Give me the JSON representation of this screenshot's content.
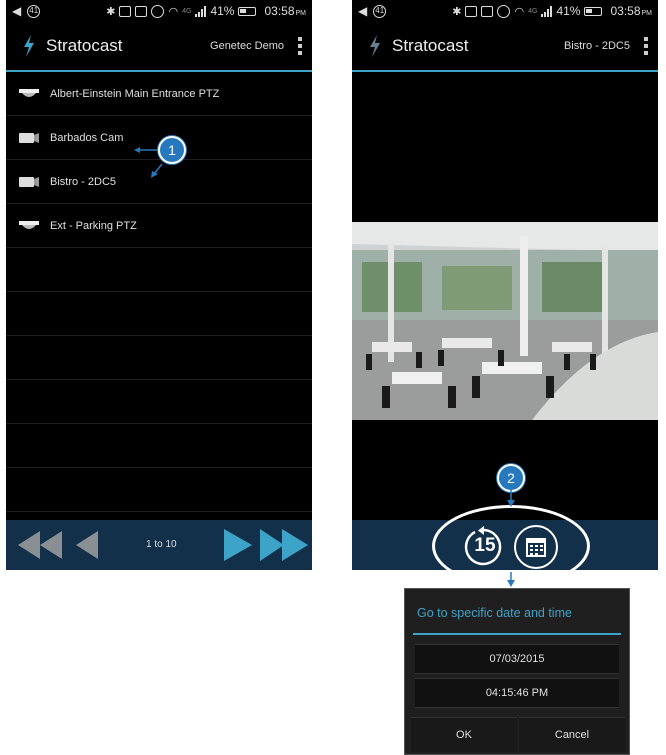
{
  "status_bar": {
    "notification_count": "41",
    "network": "4G",
    "battery": "41%",
    "time": "03:58",
    "time_suffix": "PM"
  },
  "left_screen": {
    "app_title": "Stratocast",
    "account": "Genetec Demo",
    "cameras": [
      {
        "name": "Albert-Einstein Main Entrance PTZ",
        "icon": "ptz-camera-icon"
      },
      {
        "name": "Barbados Cam",
        "icon": "fixed-camera-icon"
      },
      {
        "name": "Bistro - 2DC5",
        "icon": "fixed-camera-icon"
      },
      {
        "name": "Ext - Parking PTZ",
        "icon": "ptz-camera-icon"
      }
    ],
    "pager": {
      "range": "1 to 10"
    }
  },
  "right_screen": {
    "app_title": "Stratocast",
    "camera_name": "Bistro - 2DC5",
    "replay_label": "15",
    "dialog": {
      "title": "Go to specific date and time",
      "date": "07/03/2015",
      "time": "04:15:46 PM",
      "ok": "OK",
      "cancel": "Cancel"
    }
  },
  "callouts": {
    "one": "1",
    "two": "2"
  },
  "colors": {
    "accent": "#3ea3c8",
    "toolbar": "#123049",
    "badge": "#2878bd",
    "play": "#3ea3c8"
  }
}
